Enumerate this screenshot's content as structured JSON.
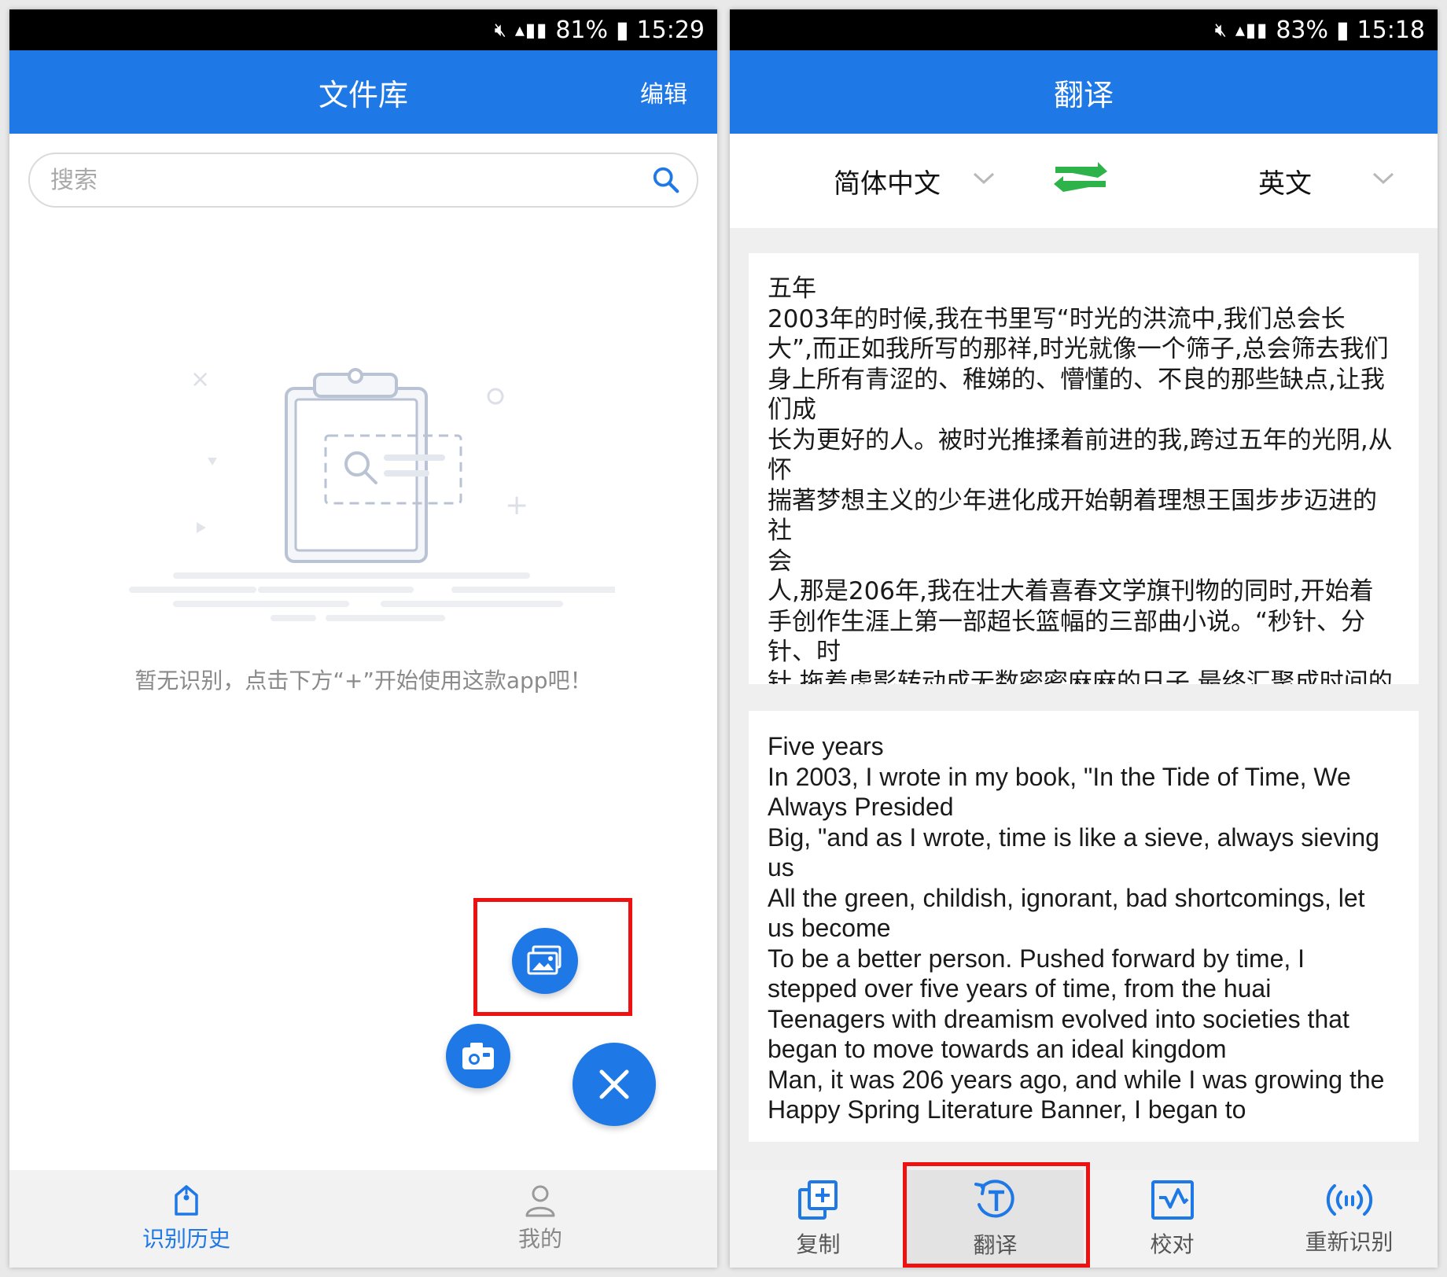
{
  "left": {
    "status": {
      "battery": "81%",
      "time": "15:29"
    },
    "header": {
      "title": "文件库",
      "edit_label": "编辑"
    },
    "search": {
      "placeholder": "搜索",
      "icon": "search-icon"
    },
    "empty_message": "暂无识别，点击下方“+”开始使用这款app吧！",
    "fab": {
      "gallery_icon": "image-icon",
      "camera_icon": "camera-icon",
      "close_icon": "close-icon"
    },
    "bottom_nav": [
      {
        "label": "识别历史",
        "icon": "tag-icon",
        "active": true
      },
      {
        "label": "我的",
        "icon": "user-icon",
        "active": false
      }
    ],
    "colors": {
      "accent": "#1e78e6",
      "highlight": "#ee1111"
    }
  },
  "right": {
    "status": {
      "battery": "83%",
      "time": "15:18"
    },
    "header": {
      "title": "翻译"
    },
    "languages": {
      "source": "简体中文",
      "target": "英文",
      "swap_icon": "swap-arrows-icon"
    },
    "source_text": "五年\n2003年的时候,我在书里写“时光的洪流中,我们总会长\n大”,而正如我所写的那祥,时光就像一个筛子,总会筛去我们\n身上所有青涩的、稚娣的、懵懂的、不良的那些缺点,让我\n们成\n长为更好的人。被时光推揉着前进的我,跨过五年的光阴,从\n怀\n揣著梦想主义的少年进化成开始朝着理想王国步步迈进的社\n会\n人,那是206年,我在壮大着喜春文学旗刊物的同时,开始着\n手创作生涯上第一部超长篮幅的三部曲小说。“秒针、分\n针、时\n针,拖着虚影转动成无数密密麻麻的日子,最终汇聚成时间的",
    "translated_text": "Five years\nIn 2003, I wrote in my book, \"In the Tide of Time, We\nAlways Presided\nBig, \"and as I wrote, time is like a sieve, always sieving\nus\nAll the green, childish, ignorant, bad shortcomings, let\nus become\nTo be a better person. Pushed forward by time, I\nstepped over five years of time, from the huai\nTeenagers with dreamism evolved into societies that\nbegan to move towards an ideal kingdom\nMan, it was 206 years ago, and while I was growing the\nHappy Spring Literature Banner, I began to",
    "toolbar": [
      {
        "label": "复制",
        "icon": "copy-icon"
      },
      {
        "label": "翻译",
        "icon": "translate-icon",
        "selected": true
      },
      {
        "label": "校对",
        "icon": "proofread-icon"
      },
      {
        "label": "重新识别",
        "icon": "re-recognize-icon"
      }
    ]
  }
}
